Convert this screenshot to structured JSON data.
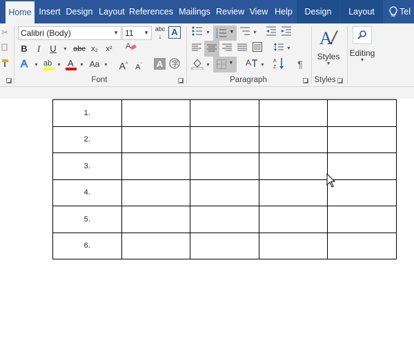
{
  "tabs": [
    {
      "label": "Home",
      "active": true
    },
    {
      "label": "Insert"
    },
    {
      "label": "Design"
    },
    {
      "label": "Layout"
    },
    {
      "label": "References"
    },
    {
      "label": "Mailings"
    },
    {
      "label": "Review"
    },
    {
      "label": "View"
    },
    {
      "label": "Help"
    }
  ],
  "context_tabs": [
    {
      "label": "Design"
    },
    {
      "label": "Layout"
    }
  ],
  "tell_me": {
    "label": "Tel"
  },
  "font": {
    "group_label": "Font",
    "font_name": "Calibri (Body)",
    "font_size": "11",
    "bold": "B",
    "italic": "I",
    "underline": "U",
    "strike": "abc",
    "subscript": "x₂",
    "superscript": "x²",
    "grow": "A",
    "shrink": "A",
    "change_case": "Aa",
    "highlight_color": "#ffff00",
    "font_color": "#e00000"
  },
  "paragraph": {
    "group_label": "Paragraph"
  },
  "styles": {
    "group_label": "Styles",
    "button_label": "Styles"
  },
  "editing": {
    "button_label": "Editing"
  },
  "accent_color": "#2b579a",
  "table": {
    "rows": [
      [
        "1.",
        "",
        "",
        "",
        ""
      ],
      [
        "2.",
        "",
        "",
        "",
        ""
      ],
      [
        "3.",
        "",
        "",
        "",
        ""
      ],
      [
        "4.",
        "",
        "",
        "",
        ""
      ],
      [
        "5.",
        "",
        "",
        "",
        ""
      ],
      [
        "6.",
        "",
        "",
        "",
        ""
      ]
    ]
  }
}
